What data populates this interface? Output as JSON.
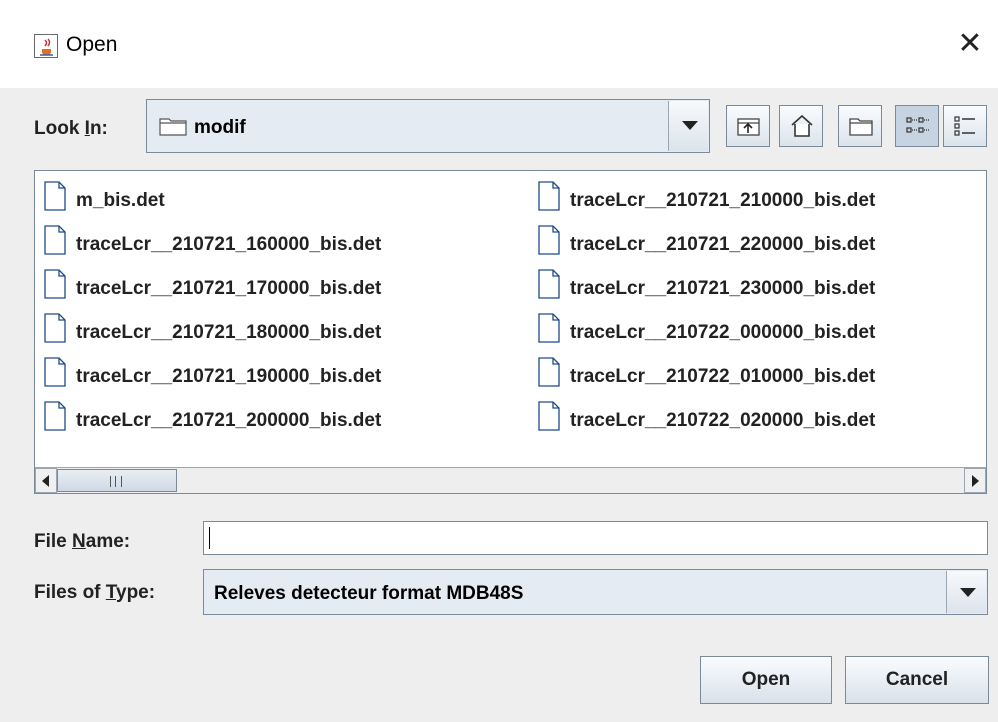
{
  "window": {
    "title": "Open",
    "icon": "java-cup-icon",
    "close_glyph": "✕"
  },
  "look_in": {
    "label_prefix": "Look ",
    "label_mnemonic": "I",
    "label_suffix": "n:",
    "value": "modif"
  },
  "toolbar": {
    "buttons": [
      "up-one-level-icon",
      "home-icon",
      "new-folder-icon",
      "list-view-icon",
      "details-view-icon"
    ],
    "selected": "list-view-icon"
  },
  "files": {
    "column1": [
      "m_bis.det",
      "traceLcr__210721_160000_bis.det",
      "traceLcr__210721_170000_bis.det",
      "traceLcr__210721_180000_bis.det",
      "traceLcr__210721_190000_bis.det",
      "traceLcr__210721_200000_bis.det"
    ],
    "column2": [
      "traceLcr__210721_210000_bis.det",
      "traceLcr__210721_220000_bis.det",
      "traceLcr__210721_230000_bis.det",
      "traceLcr__210722_000000_bis.det",
      "traceLcr__210722_010000_bis.det",
      "traceLcr__210722_020000_bis.det"
    ]
  },
  "file_name": {
    "label_prefix": "File ",
    "label_mnemonic": "N",
    "label_suffix": "ame:",
    "value": ""
  },
  "file_type": {
    "label_prefix": "Files of ",
    "label_mnemonic": "T",
    "label_suffix": "ype:",
    "value": "Releves detecteur format MDB48S"
  },
  "buttons": {
    "open": "Open",
    "cancel": "Cancel"
  },
  "colors": {
    "background": "#eeeeee",
    "combo_fill": "#e4ebf3",
    "border": "#7a8a99"
  }
}
